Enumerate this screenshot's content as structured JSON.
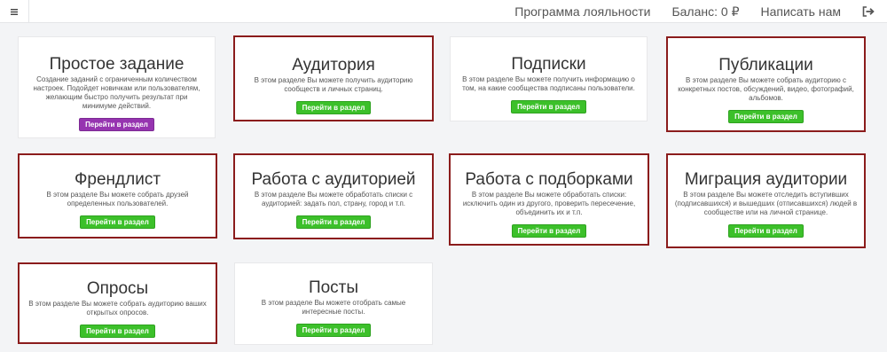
{
  "topbar": {
    "menu_icon": "hamburger-icon",
    "links": {
      "loyalty": "Программа лояльности",
      "balance": "Баланс: 0 ₽",
      "contact": "Написать нам"
    },
    "exit_icon": "sign-out-icon"
  },
  "colors": {
    "highlight_border": "#8b1c1c",
    "button_green": "#3cc02a",
    "button_purple": "#9634b0",
    "background": "#f3f4f6"
  },
  "cards": {
    "simple": {
      "title": "Простое задание",
      "desc": "Создание заданий с ограниченным количеством настроек. Подойдет новичкам или пользователям, желающим быстро получить результат при минимуме действий.",
      "button": "Перейти в раздел"
    },
    "audience": {
      "title": "Аудитория",
      "desc": "В этом разделе Вы можете получить аудиторию сообществ и личных страниц.",
      "button": "Перейти в раздел"
    },
    "subscriptions": {
      "title": "Подписки",
      "desc": "В этом разделе Вы можете получить информацию о том, на какие сообщества подписаны пользователи.",
      "button": "Перейти в раздел"
    },
    "publications": {
      "title": "Публикации",
      "desc": "В этом разделе Вы можете собрать аудиторию с конкретных постов, обсуждений, видео, фотографий, альбомов.",
      "button": "Перейти в раздел"
    },
    "friendlist": {
      "title": "Френдлист",
      "desc": "В этом разделе Вы можете собрать друзей определенных пользователей.",
      "button": "Перейти в раздел"
    },
    "audience_work": {
      "title": "Работа с аудиторией",
      "desc": "В этом разделе Вы можете обработать списки с аудиторией: задать пол, страну, город и т.п.",
      "button": "Перейти в раздел"
    },
    "collections": {
      "title": "Работа с подборками",
      "desc": "В этом разделе Вы можете обработать списки: исключить один из другого, проверить пересечение, объединить их и т.п.",
      "button": "Перейти в раздел"
    },
    "migration": {
      "title": "Миграция аудитории",
      "desc": "В этом разделе Вы можете отследить вступивших (подписавшихся) и вышедших (отписавшихся) людей в сообществе или на личной странице.",
      "button": "Перейти в раздел"
    },
    "polls": {
      "title": "Опросы",
      "desc": "В этом разделе Вы можете собрать аудиторию ваших открытых опросов.",
      "button": "Перейти в раздел"
    },
    "posts": {
      "title": "Посты",
      "desc": "В этом разделе Вы можете отобрать самые интересные посты.",
      "button": "Перейти в раздел"
    }
  }
}
